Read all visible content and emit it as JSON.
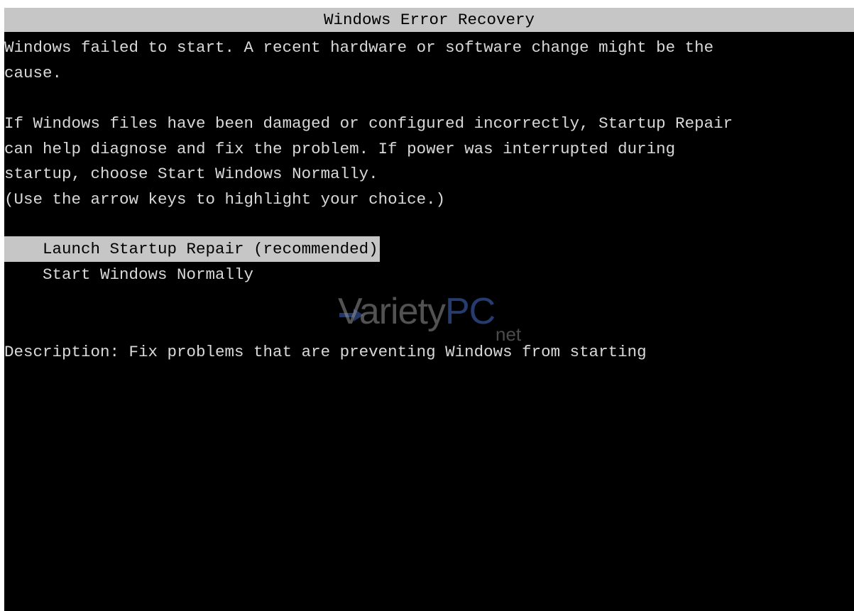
{
  "window": {
    "title": "Windows Error Recovery"
  },
  "message": {
    "line1": "Windows failed to start. A recent hardware or software change might be the",
    "line2": "cause.",
    "line3": "If Windows files have been damaged or configured incorrectly, Startup Repair",
    "line4": "can help diagnose and fix the problem. If power was interrupted during",
    "line5": "startup, choose Start Windows Normally.",
    "line6": "(Use the arrow keys to highlight your choice.)"
  },
  "menu": {
    "items": [
      {
        "label": "    Launch Startup Repair (recommended)",
        "selected": true
      },
      {
        "label": "    Start Windows Normally",
        "selected": false
      }
    ]
  },
  "description": {
    "text": "Description: Fix problems that are preventing Windows from starting"
  },
  "watermark": {
    "brand_part1": "Variety",
    "brand_part2": "PC",
    "suffix": "net"
  },
  "colors": {
    "background": "#000000",
    "text": "#d9d9d9",
    "highlight": "#c6c6c6"
  }
}
